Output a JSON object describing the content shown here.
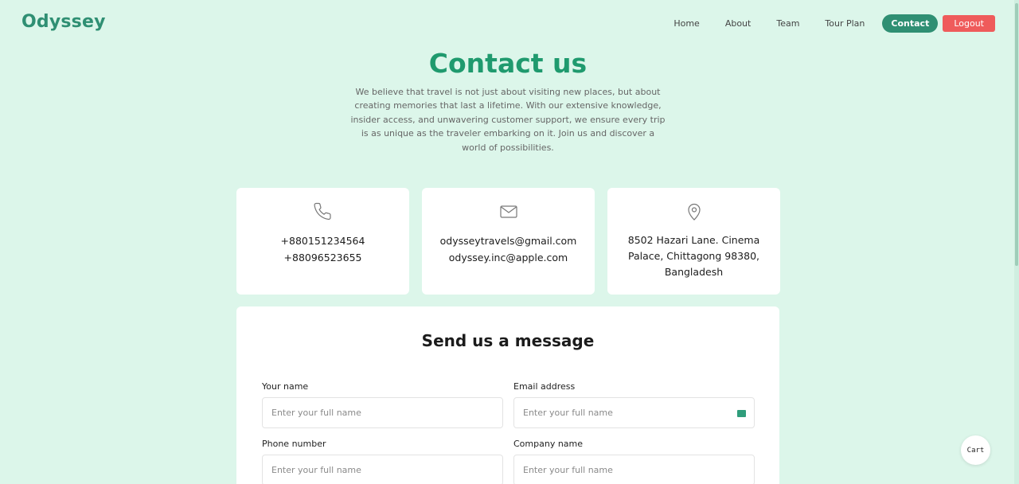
{
  "brand": {
    "logo_text": "Odyssey"
  },
  "nav": {
    "home": "Home",
    "about": "About",
    "team": "Team",
    "tour_plan": "Tour Plan",
    "contact": "Contact",
    "logout": "Logout"
  },
  "hero": {
    "title": "Contact us",
    "intro": "We believe that travel is not just about visiting new places, but about creating memories that last a lifetime. With our extensive knowledge, insider access, and unwavering customer support, we ensure every trip is as unique as the traveler embarking on it. Join us and discover a world of possibilities."
  },
  "contact_cards": {
    "phone": {
      "icon": "phone-icon",
      "line1": "+880151234564",
      "line2": "+88096523655"
    },
    "email": {
      "icon": "mail-icon",
      "line1": "odysseytravels@gmail.com",
      "line2": "odyssey.inc@apple.com"
    },
    "address": {
      "icon": "location-pin-icon",
      "text": "8502 Hazari Lane. Cinema Palace, Chittagong 98380, Bangladesh"
    }
  },
  "form": {
    "title": "Send us a message",
    "name_label": "Your name",
    "name_placeholder": "Enter your full name",
    "email_label": "Email address",
    "email_placeholder": "Enter your full name",
    "phone_label": "Phone number",
    "phone_placeholder": "Enter your full name",
    "company_label": "Company name",
    "company_placeholder": "Enter your full name"
  },
  "cart": {
    "label": "Cart"
  },
  "colors": {
    "background": "#dcf6ea",
    "brand_green": "#2f8f73",
    "title_green": "#1f9a6e",
    "logout_red": "#ef5b5b"
  }
}
